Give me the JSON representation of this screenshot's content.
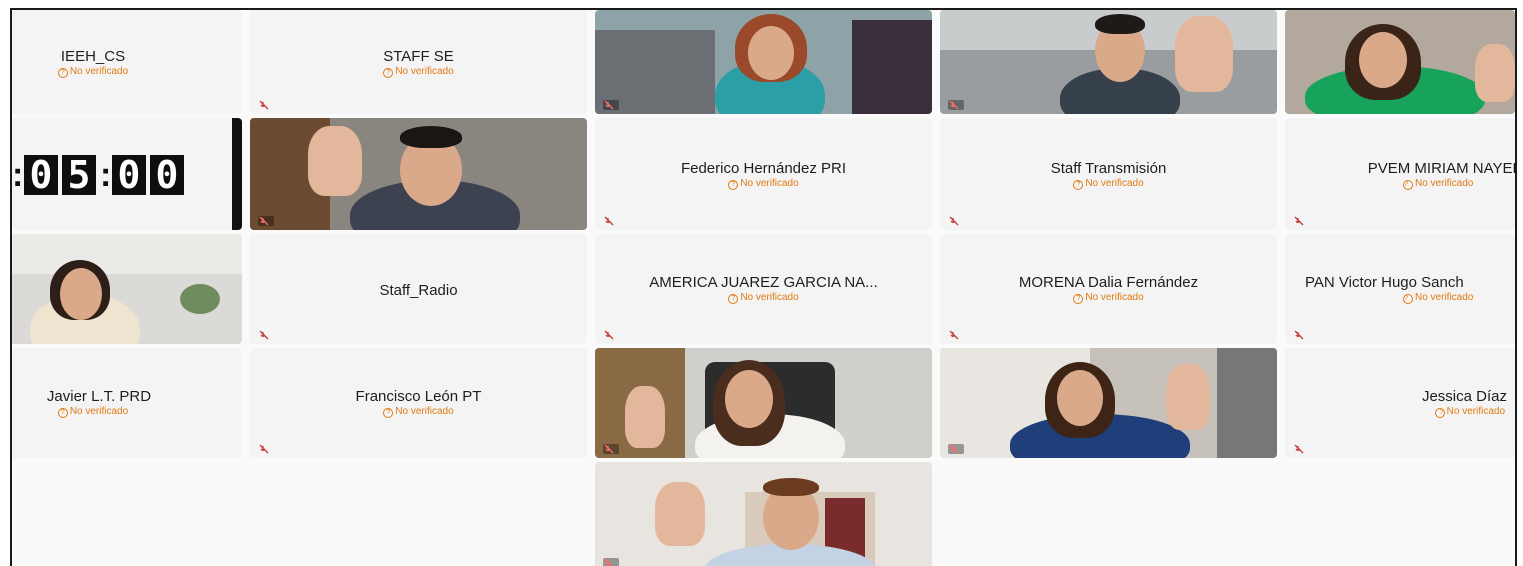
{
  "status_label": "No verificado",
  "tiles": {
    "ieeh_cs": {
      "name": "IEEH_CS"
    },
    "staff_se": {
      "name": "STAFF SE"
    },
    "federico": {
      "name": "Federico Hernández PRI"
    },
    "staff_transmision": {
      "name": "Staff Transmisión"
    },
    "pvem": {
      "name": "PVEM MIRIAM NAYELI"
    },
    "staff_radio": {
      "name": "Staff_Radio"
    },
    "america": {
      "name": "AMERICA JUAREZ GARCIA NA..."
    },
    "morena": {
      "name": "MORENA Dalia Fernández"
    },
    "pan": {
      "name": "PAN Victor Hugo Sanch"
    },
    "javier": {
      "name": "Javier L.T. PRD"
    },
    "francisco": {
      "name": "Francisco León PT"
    },
    "jessica": {
      "name": "Jessica Díaz"
    }
  },
  "timer": {
    "d1": "0",
    "d2": "5",
    "d3": "0",
    "d4": "0"
  },
  "colors": {
    "warning": "#e07a12",
    "tile_bg": "#f4f4f4",
    "timer_bg": "#0e0e0e"
  },
  "icons": {
    "muted": "microphone-off-icon",
    "status": "question-circle-icon"
  }
}
